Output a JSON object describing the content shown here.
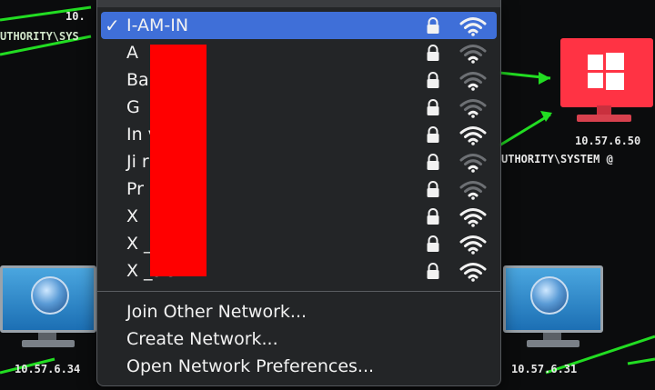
{
  "background": {
    "labels": {
      "top_left_ip": "10.",
      "top_left_user": "UTHORITY\\SYS",
      "right_ip": "10.57.6.50",
      "right_user": "UTHORITY\\SYSTEM @",
      "bottom_left_ip": "10.57.6.34",
      "bottom_right_ip": "10.57.6.31"
    },
    "colors": {
      "link": "#22dd22",
      "session_host": "#ff3344"
    }
  },
  "wifi_menu": {
    "networks": [
      {
        "name": "I-AM-IN",
        "connected": true,
        "locked": true,
        "signal": "full"
      },
      {
        "name": "A",
        "connected": false,
        "locked": true,
        "signal": "weak"
      },
      {
        "name": "Ba",
        "connected": false,
        "locked": true,
        "signal": "weak"
      },
      {
        "name": "G",
        "connected": false,
        "locked": true,
        "signal": "weak"
      },
      {
        "name": "In          vat",
        "connected": false,
        "locked": true,
        "signal": "full"
      },
      {
        "name": "Ji          r2.4G",
        "connected": false,
        "locked": true,
        "signal": "weak"
      },
      {
        "name": "Pr",
        "connected": false,
        "locked": true,
        "signal": "weak"
      },
      {
        "name": "X",
        "connected": false,
        "locked": true,
        "signal": "full"
      },
      {
        "name": "X          _2G",
        "connected": false,
        "locked": true,
        "signal": "full"
      },
      {
        "name": "X          _5G",
        "connected": false,
        "locked": true,
        "signal": "full"
      }
    ],
    "actions": [
      "Join Other Network...",
      "Create Network...",
      "Open Network Preferences..."
    ],
    "check_glyph": "✓",
    "colors": {
      "selected": "#3f6fd8",
      "redaction": "#ff0000"
    }
  }
}
